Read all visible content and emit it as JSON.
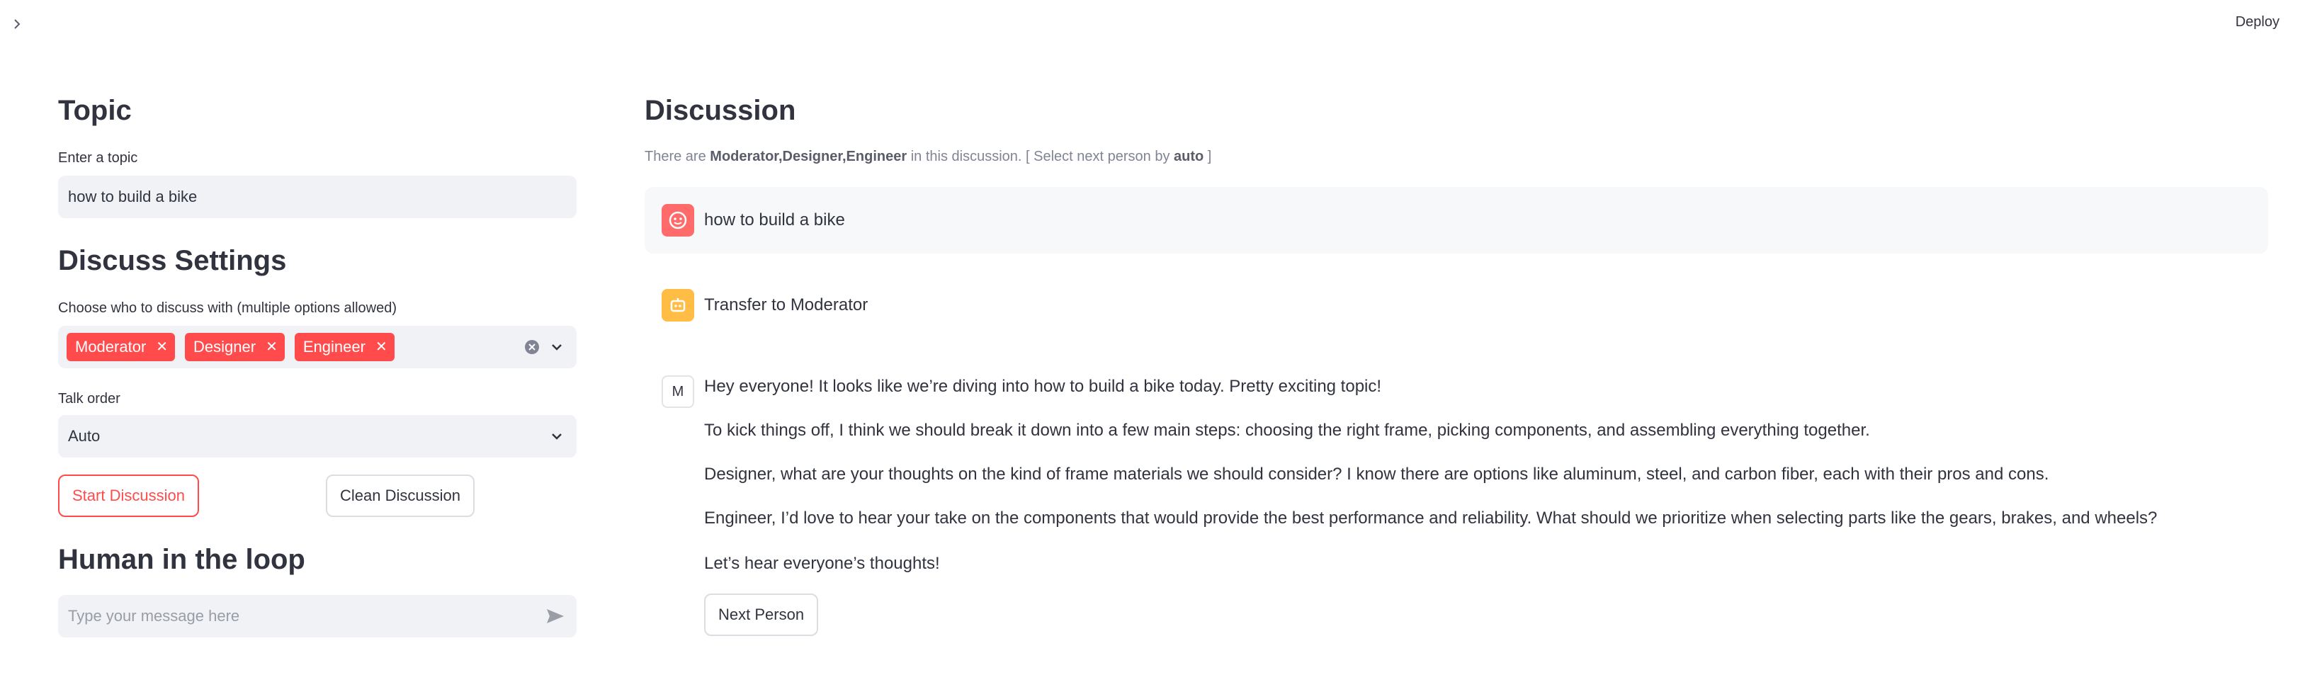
{
  "header": {
    "deploy_label": "Deploy"
  },
  "left": {
    "topic_title": "Topic",
    "topic_label": "Enter a topic",
    "topic_value": "how to build a bike",
    "settings_title": "Discuss Settings",
    "participants_label": "Choose who to discuss with (multiple options allowed)",
    "participants": [
      "Moderator",
      "Designer",
      "Engineer"
    ],
    "talk_order_label": "Talk order",
    "talk_order_value": "Auto",
    "start_label": "Start Discussion",
    "clean_label": "Clean Discussion",
    "hitl_title": "Human in the loop",
    "message_placeholder": "Type your message here"
  },
  "discussion": {
    "title": "Discussion",
    "caption_prefix": "There are",
    "caption_people": "Moderator,Designer,Engineer",
    "caption_mid": "in this discussion. [ Select next person by",
    "caption_mode": "auto",
    "caption_suffix": "]",
    "messages": [
      {
        "avatar": "user-icon",
        "text": "how to build a bike"
      },
      {
        "avatar": "robot-icon",
        "text": "Transfer to Moderator"
      },
      {
        "avatar_letter": "M",
        "paragraphs": [
          "Hey everyone! It looks like we’re diving into how to build a bike today. Pretty exciting topic!",
          "To kick things off, I think we should break it down into a few main steps: choosing the right frame, picking components, and assembling everything together.",
          "Designer, what are your thoughts on the kind of frame materials we should consider? I know there are options like aluminum, steel, and carbon fiber, each with their pros and cons.",
          "Engineer, I’d love to hear your take on the components that would provide the best performance and reliability. What should we prioritize when selecting parts like the gears, brakes, and wheels?",
          "Let’s hear everyone’s thoughts!"
        ]
      }
    ],
    "next_person_label": "Next Person"
  },
  "colors": {
    "accent": "#ff4b4b",
    "input_bg": "#f0f2f6",
    "user_avatar": "#ff6b6b",
    "bot_avatar": "#ffbd45"
  }
}
